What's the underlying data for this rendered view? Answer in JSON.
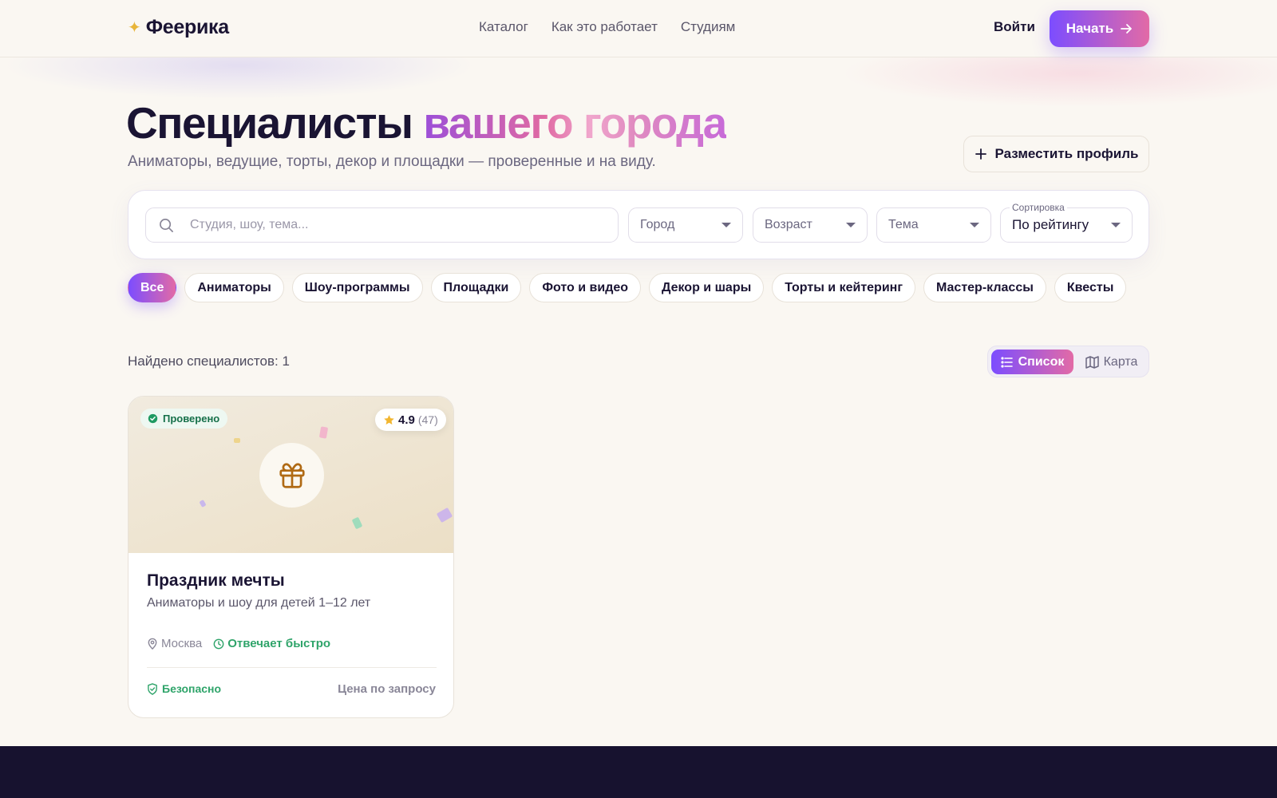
{
  "header": {
    "logo": "Феерика",
    "nav": [
      "Каталог",
      "Как это работает",
      "Студиям"
    ],
    "login": "Войти",
    "start": "Начать"
  },
  "hero": {
    "title_main": "Специалисты",
    "title_accent": "вашего города",
    "subtitle": "Аниматоры, ведущие, торты, декор и площадки — проверенные и на виду.",
    "place_profile": "Разместить профиль"
  },
  "filters": {
    "search_placeholder": "Студия, шоу, тема...",
    "city": "Город",
    "age": "Возраст",
    "theme": "Тема",
    "sort_label": "Сортировка",
    "sort_value": "По рейтингу"
  },
  "categories": [
    "Все",
    "Аниматоры",
    "Шоу-программы",
    "Площадки",
    "Фото и видео",
    "Декор и шары",
    "Торты и кейтеринг",
    "Мастер-классы",
    "Квесты"
  ],
  "results": {
    "found": "Найдено специалистов: 1",
    "view_list": "Список",
    "view_map": "Карта"
  },
  "card": {
    "verified": "Проверено",
    "rating": "4.9",
    "reviews": "(47)",
    "title": "Праздник мечты",
    "description": "Аниматоры и шоу для детей 1–12 лет",
    "city": "Москва",
    "response": "Отвечает быстро",
    "safe": "Безопасно",
    "price": "Цена по запросу"
  },
  "colors": {
    "accent_start": "#7c4dff",
    "accent_end": "#e26aa6",
    "success": "#2fa46a",
    "footer": "#17122f"
  }
}
